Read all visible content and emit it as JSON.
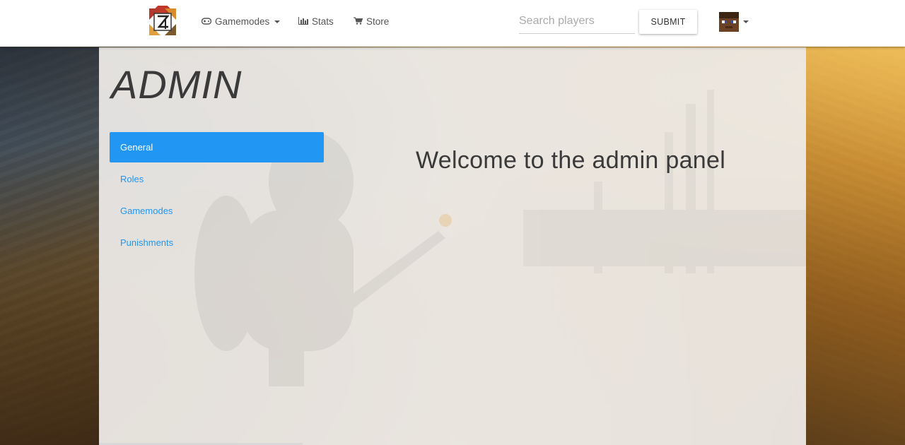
{
  "navbar": {
    "brand": "Zeta",
    "links": [
      {
        "label": "Gamemodes",
        "icon": "gamepad-icon",
        "dropdown": true
      },
      {
        "label": "Stats",
        "icon": "bar-chart-icon"
      },
      {
        "label": "Store",
        "icon": "shopping-cart-icon"
      }
    ],
    "search_placeholder": "Search players",
    "search_value": "",
    "submit_label": "SUBMIT"
  },
  "page": {
    "title": "ADMIN",
    "welcome": "Welcome to the admin panel"
  },
  "sidebar": {
    "items": [
      {
        "label": "General",
        "active": true
      },
      {
        "label": "Roles",
        "active": false
      },
      {
        "label": "Gamemodes",
        "active": false
      },
      {
        "label": "Punishments",
        "active": false
      }
    ]
  },
  "colors": {
    "accent": "#2196f3",
    "navbar_bg": "#ffffff",
    "text_dark": "#3a3a3a"
  }
}
